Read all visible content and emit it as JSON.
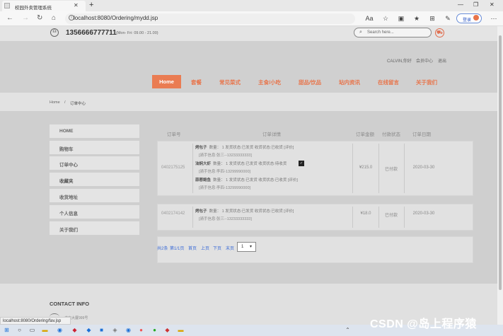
{
  "browser": {
    "tab_title": "校园外卖管理系统",
    "url": "localhost:8080/Ordering/mydd.jsp",
    "login_label": "登录"
  },
  "topbar": {
    "phone": "1356666777711",
    "hours": "(Mon- Fri: 09.00 - 21.00)",
    "search_placeholder": "Search here..."
  },
  "user_links": [
    "CALVIN,你好",
    "会员中心",
    "退出"
  ],
  "nav": [
    "Home",
    "套餐",
    "常见菜式",
    "主食/小吃",
    "甜品/饮品",
    "站内资讯",
    "在线留言",
    "关于我们"
  ],
  "breadcrumb": {
    "home": "Home",
    "sep": "/",
    "current": "订单中心"
  },
  "sidebar": [
    "HOME",
    "购物车",
    "订单中心",
    "收藏夹",
    "收货地址",
    "个人信息",
    "关于我们"
  ],
  "table_headers": [
    "订单号",
    "订单详情",
    "订单金额",
    "付款状态",
    "订单日期"
  ],
  "orders": [
    {
      "id": "0402175125",
      "items": [
        {
          "name": "烤包子",
          "detail": "数量：  1    发货状态:已发货    收货状态:已收货 [评价]",
          "rider": "[骑手信息:张三--13233333333]"
        },
        {
          "name": "油焖大虾",
          "detail": "数量：  1    发货状态:已发货    收货状态:待收货",
          "rider": "[骑手信息:李四-13299990000]"
        },
        {
          "name": "蒜蓉鲍鱼",
          "detail": "数量：  1    发货状态:已发货    收货状态:已收货 [评价]",
          "rider": "[骑手信息:李四-13299990000]"
        }
      ],
      "amount": "¥215.0",
      "pay_status": "已付款",
      "date": "2020-03-30"
    },
    {
      "id": "0402174142",
      "items": [
        {
          "name": "烤包子",
          "detail": "数量：  1    发货状态:已发货    收货状态:已收货 [评价]",
          "rider": "[骑手信息:张三--13233333333]"
        }
      ],
      "amount": "¥18.0",
      "pay_status": "已付款",
      "date": "2020-03-30"
    }
  ],
  "pager": {
    "total": "共2条",
    "page": "第1/1页",
    "first": "首页",
    "prev": "上页",
    "next": "下页",
    "last": "末页",
    "select_value": "1"
  },
  "footer": {
    "title": "CONTACT INFO",
    "address": "书店大厦999号"
  },
  "status_url": "localhost:8080/Ordering/fav.jsp",
  "watermark": "CSDN @岛上程序猿",
  "colors": {
    "accent": "#ea7c52",
    "link": "#3a6ad6"
  }
}
